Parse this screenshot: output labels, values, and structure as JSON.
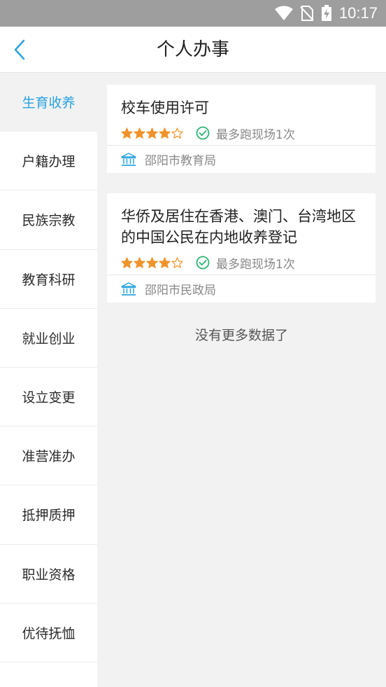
{
  "status_bar": {
    "time": "10:17",
    "icons": [
      "wifi-icon",
      "no-sim-icon",
      "battery-charging-icon"
    ]
  },
  "header": {
    "title": "个人办事",
    "back_icon": "chevron-left-icon"
  },
  "colors": {
    "accent": "#2aa3e0",
    "star": "#f0932b",
    "check": "#2bb673",
    "gov_icon": "#2aa3e0"
  },
  "sidebar": {
    "items": [
      {
        "label": "生育收养",
        "active": true
      },
      {
        "label": "户籍办理",
        "active": false
      },
      {
        "label": "民族宗教",
        "active": false
      },
      {
        "label": "教育科研",
        "active": false
      },
      {
        "label": "就业创业",
        "active": false
      },
      {
        "label": "设立变更",
        "active": false
      },
      {
        "label": "准营准办",
        "active": false
      },
      {
        "label": "抵押质押",
        "active": false
      },
      {
        "label": "职业资格",
        "active": false
      },
      {
        "label": "优待抚恤",
        "active": false
      }
    ]
  },
  "services": [
    {
      "name": "校车使用许可",
      "rating": 4,
      "rating_max": 5,
      "visits": "最多跑现场1次",
      "department": "邵阳市教育局"
    },
    {
      "name": "华侨及居住在香港、澳门、台湾地区的中国公民在内地收养登记",
      "rating": 4,
      "rating_max": 5,
      "visits": "最多跑现场1次",
      "department": "邵阳市民政局"
    }
  ],
  "footer": {
    "no_more": "没有更多数据了"
  }
}
